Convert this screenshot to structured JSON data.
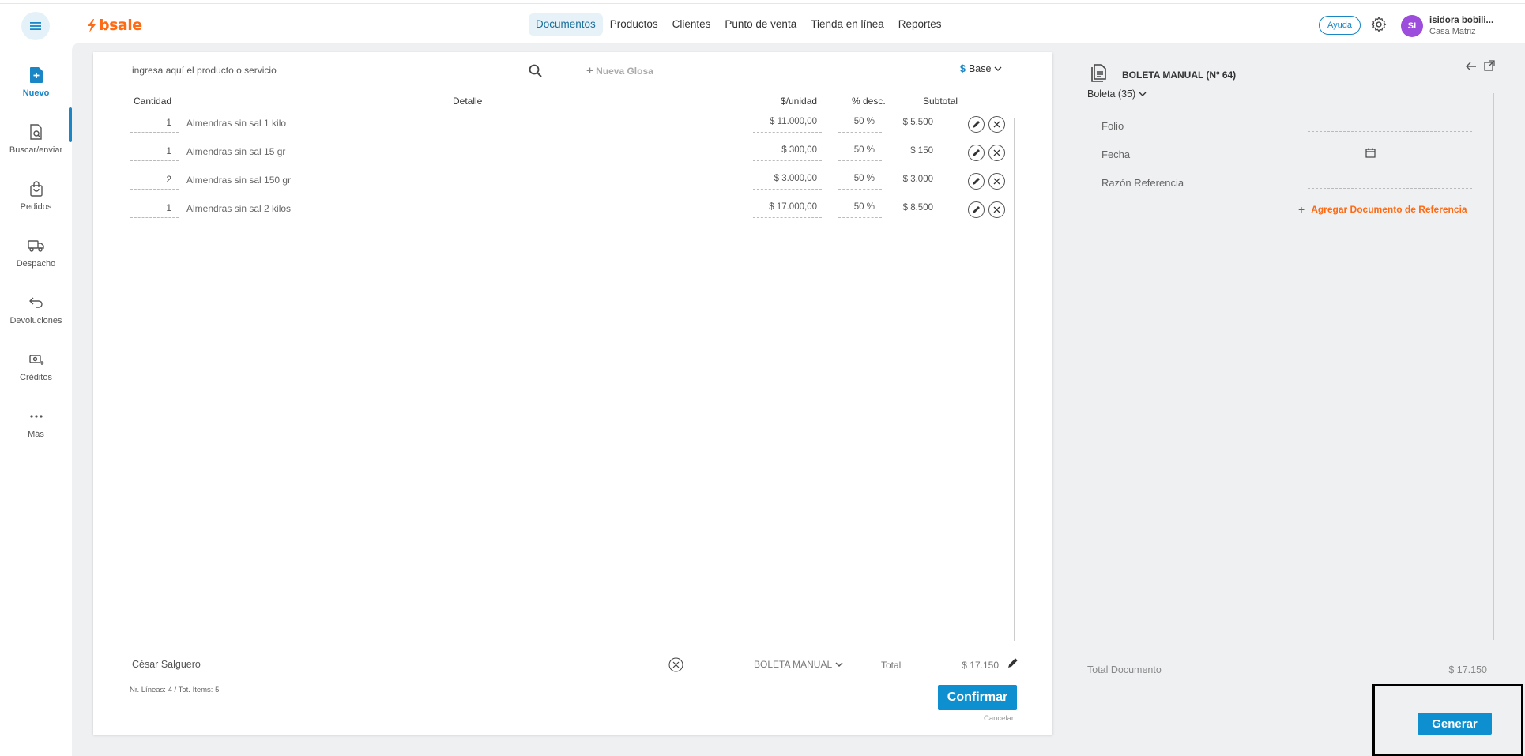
{
  "brand": {
    "logo_text": "bsale",
    "accent": "#ff6a13",
    "primary": "#0e8fcf"
  },
  "nav": {
    "items": [
      {
        "label": "Documentos",
        "active": true
      },
      {
        "label": "Productos"
      },
      {
        "label": "Clientes"
      },
      {
        "label": "Punto de venta"
      },
      {
        "label": "Tienda en línea"
      },
      {
        "label": "Reportes"
      }
    ]
  },
  "header": {
    "help_label": "Ayuda",
    "avatar_initials": "SI",
    "user_name": "isidora bobili...",
    "branch": "Casa Matriz"
  },
  "sidebar": {
    "items": [
      {
        "label": "Nuevo",
        "icon": "new-document-icon",
        "active": true
      },
      {
        "label": "Buscar/enviar",
        "icon": "search-document-icon"
      },
      {
        "label": "Pedidos",
        "icon": "shopping-bag-icon"
      },
      {
        "label": "Despacho",
        "icon": "truck-icon"
      },
      {
        "label": "Devoluciones",
        "icon": "return-arrow-icon"
      },
      {
        "label": "Créditos",
        "icon": "credit-icon"
      },
      {
        "label": "Más",
        "icon": "more-dots-icon"
      }
    ]
  },
  "document": {
    "search_placeholder": "ingresa aquí el producto o servicio",
    "nueva_glosa": "Nueva Glosa",
    "price_list": {
      "symbol": "$",
      "label": "Base"
    },
    "columns": {
      "cantidad": "Cantidad",
      "detalle": "Detalle",
      "unidad": "$/unidad",
      "desc": "% desc.",
      "subtotal": "Subtotal"
    },
    "rows": [
      {
        "qty": "1",
        "detail": "Almendras sin sal 1 kilo",
        "price": "$ 11.000,00",
        "disc": "50 %",
        "subtotal": "$ 5.500"
      },
      {
        "qty": "1",
        "detail": "Almendras sin sal 15 gr",
        "price": "$ 300,00",
        "disc": "50 %",
        "subtotal": "$ 150"
      },
      {
        "qty": "2",
        "detail": "Almendras sin sal 150 gr",
        "price": "$ 3.000,00",
        "disc": "50 %",
        "subtotal": "$ 3.000"
      },
      {
        "qty": "1",
        "detail": "Almendras sin sal 2 kilos",
        "price": "$ 17.000,00",
        "disc": "50 %",
        "subtotal": "$ 8.500"
      }
    ],
    "client_value": "César Salguero",
    "doc_type": "BOLETA MANUAL",
    "total_label": "Total",
    "total_value": "$ 17.150",
    "lines_info": "Nr. Líneas: 4 / Tot. Ítems: 5",
    "confirm_label": "Confirmar",
    "cancel_label": "Cancelar"
  },
  "right_panel": {
    "title": "BOLETA MANUAL (Nº 64)",
    "doc_subtype": "Boleta (35)",
    "fields": {
      "folio": "Folio",
      "fecha": "Fecha",
      "razon": "Razón Referencia"
    },
    "add_reference": "Agregar Documento de Referencia",
    "total_label": "Total Documento",
    "total_value": "$ 17.150",
    "generate_label": "Generar"
  }
}
